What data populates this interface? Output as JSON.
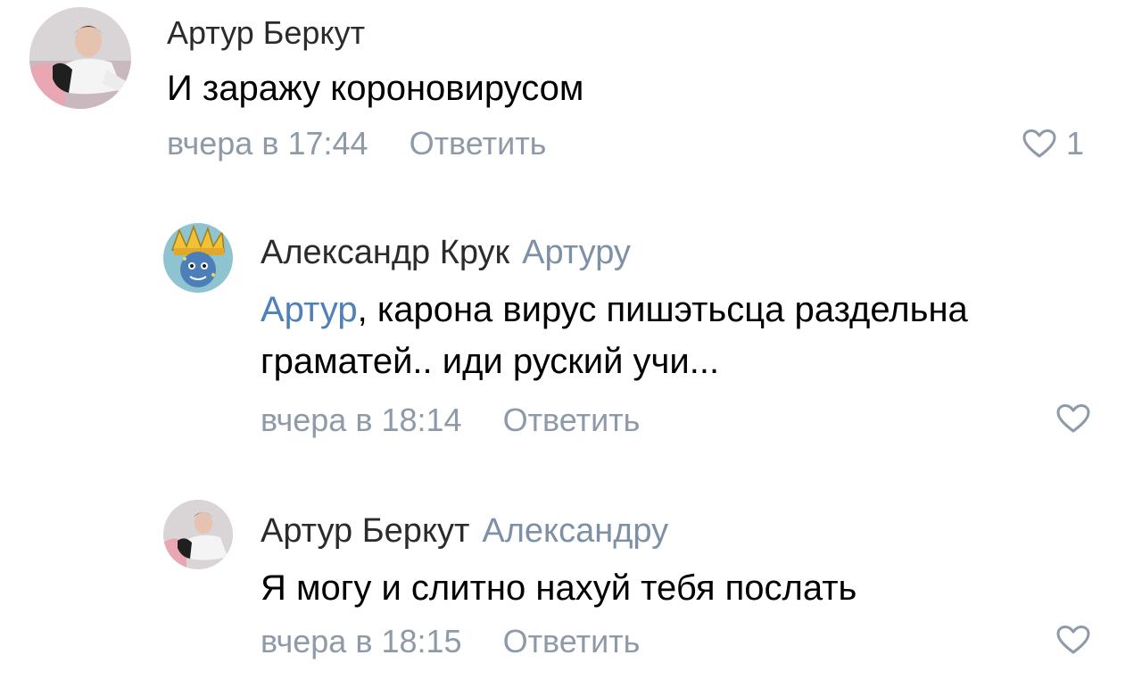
{
  "comments": [
    {
      "author": "Артур Беркут",
      "reply_to": "",
      "mention": "",
      "text": "И заражу короновирусом",
      "time": "вчера в 17:44",
      "reply_label": "Ответить",
      "likes": "1"
    },
    {
      "author": "Александр Крук",
      "reply_to": "Артуру",
      "mention": "Артур",
      "text": ", карона вирус пишэтьсца раздельна граматей.. иди руский учи...",
      "time": "вчера в 18:14",
      "reply_label": "Ответить",
      "likes": ""
    },
    {
      "author": "Артур Беркут",
      "reply_to": "Александру",
      "mention": "",
      "text": "Я могу и слитно нахуй тебя послать",
      "time": "вчера в 18:15",
      "reply_label": "Ответить",
      "likes": ""
    }
  ],
  "icons": {
    "like": "heart-outline-icon"
  },
  "colors": {
    "meta": "#8e9aa8",
    "mention": "#4f80b9",
    "reply_to": "#7d90a6"
  }
}
